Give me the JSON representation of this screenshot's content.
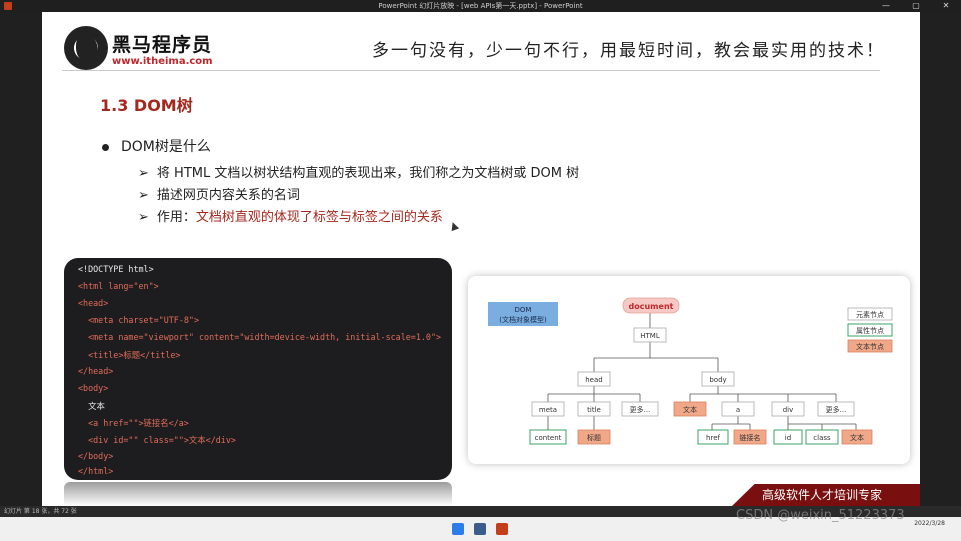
{
  "window": {
    "title": "PowerPoint 幻灯片放映 - [web APIs第一天.pptx] - PowerPoint",
    "controls": [
      "—",
      "▢",
      "✕"
    ]
  },
  "slide": {
    "logo_cn": "黑马程序员",
    "logo_url": "www.itheima.com",
    "slogan": "多一句没有，少一句不行，用最短时间，教会最实用的技术！",
    "heading": "1.3 DOM树",
    "bullet": "DOM树是什么",
    "sub_items": [
      {
        "arrow": "➢",
        "text": "将 HTML 文档以树状结构直观的表现出来，我们称之为文档树或 DOM 树"
      },
      {
        "arrow": "➢",
        "text": "描述网页内容关系的名词"
      },
      {
        "arrow": "➢",
        "prefix": "作用：",
        "highlight": "文档树直观的体现了标签与标签之间的关系"
      }
    ],
    "code_lines": [
      "<!DOCTYPE html>",
      "<html lang=\"en\">",
      "<head>",
      "  <meta charset=\"UTF-8\">",
      "  <meta name=\"viewport\" content=\"width=device-width, initial-scale=1.0\">",
      "  <title>标题</title>",
      "</head>",
      "<body>",
      "  文本",
      "  <a href=\"\">链接名</a>",
      "  <div id=\"\" class=\"\">文本</div>",
      "</body>",
      "</html>"
    ],
    "tree": {
      "dom_label_1": "DOM",
      "dom_label_2": "(文档对象模型)",
      "root": "document",
      "html": "HTML",
      "head": "head",
      "body": "body",
      "head_children": [
        "meta",
        "title",
        "更多..."
      ],
      "body_children": [
        "文本",
        "a",
        "div",
        "更多..."
      ],
      "meta_child": "content",
      "title_child": "标题",
      "a_children": [
        "href",
        "链接名"
      ],
      "div_children": [
        "id",
        "class",
        "文本"
      ],
      "legend": [
        "元素节点",
        "属性节点",
        "文本节点"
      ]
    },
    "banner": "高级软件人才培训专家"
  },
  "colors": {
    "accent_red": "#a3281e",
    "dom_blue": "#7aaee0",
    "attr_green": "#3aa36a",
    "text_node": "#f0a888",
    "root_pink": "#f6c9c4"
  },
  "statusbar": {
    "slide_count": "幻灯片 第 18 张，共 72 张"
  },
  "taskbar": {
    "time": "2022/3/28"
  },
  "watermark": "CSDN @weixin_51223373"
}
